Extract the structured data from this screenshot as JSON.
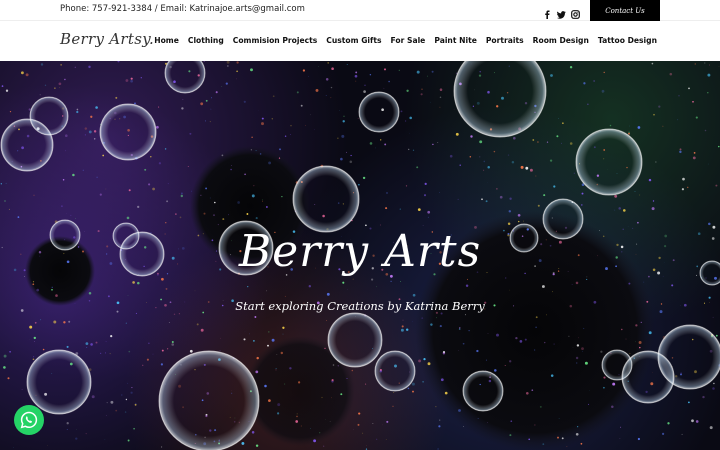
{
  "topbar": {
    "contact_text": "Phone: 757-921-3384 / Email: Katrinajoe.arts@gmail.com",
    "socials": [
      "facebook-icon",
      "twitter-icon",
      "instagram-icon"
    ],
    "contact_button": "Contact Us"
  },
  "header": {
    "logo": "Berry Artsy.",
    "menu": [
      "Home",
      "Clothing",
      "Commision Projects",
      "Custom Gifts",
      "For Sale",
      "Paint Nite",
      "Portraits",
      "Room Design",
      "Tattoo Design"
    ]
  },
  "hero": {
    "title": "Berry Arts",
    "subtitle": "Start exploring Creations by Katrina Berry"
  },
  "colors": {
    "whatsapp": "#25d366",
    "accent": "#000000"
  },
  "floating": {
    "whatsapp_icon": "whatsapp-icon"
  }
}
